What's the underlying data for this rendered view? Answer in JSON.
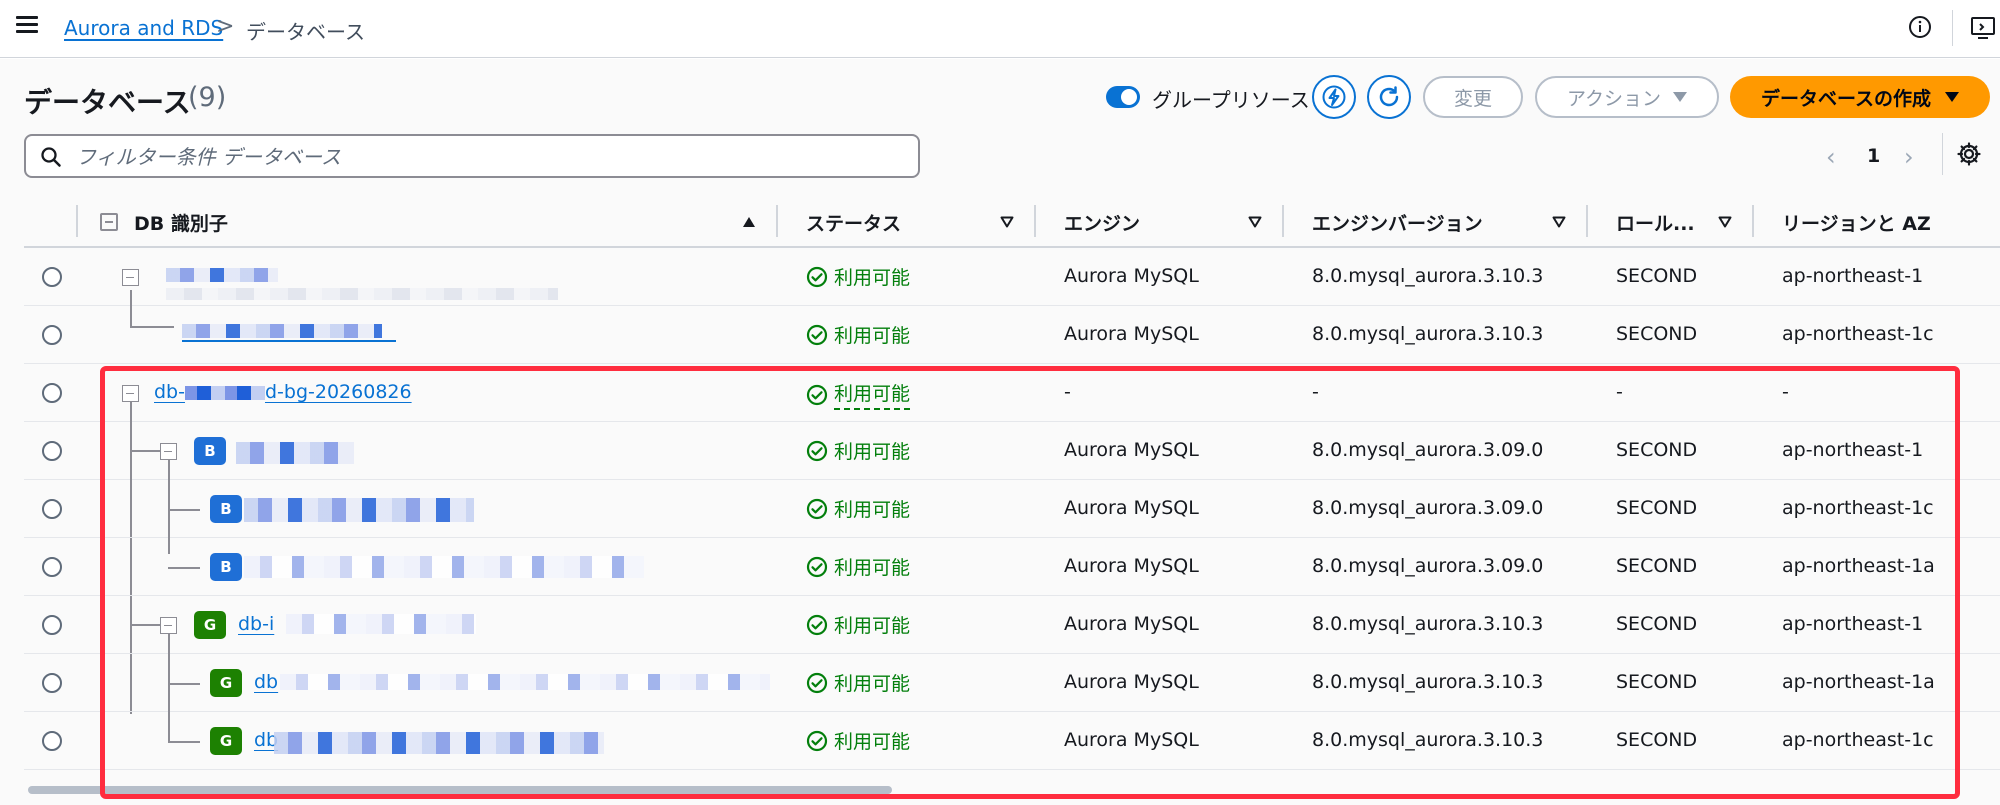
{
  "breadcrumb": {
    "root": "Aurora and RDS",
    "separator": ">",
    "current": "データベース"
  },
  "header": {
    "title": "データベース",
    "count": "(9)",
    "group_toggle_label": "グループリソース",
    "group_toggle_on": true,
    "modify_label": "変更",
    "actions_label": "アクション",
    "create_label": "データベースの作成"
  },
  "search": {
    "placeholder": "フィルター条件 データベース",
    "value": ""
  },
  "pagination": {
    "page": "1"
  },
  "table": {
    "columns": {
      "identifier": "DB 識別子",
      "status": "ステータス",
      "engine": "エンジン",
      "engine_version": "エンジンバージョン",
      "role": "ロール...",
      "region": "リージョンと AZ"
    },
    "rows": [
      {
        "identifier": "",
        "status": "利用可能",
        "engine": "Aurora MySQL",
        "version": "8.0.mysql_aurora.3.10.3",
        "role": "SECOND",
        "region": "ap-northeast-1"
      },
      {
        "identifier": "",
        "status": "利用可能",
        "engine": "Aurora MySQL",
        "version": "8.0.mysql_aurora.3.10.3",
        "role": "SECOND",
        "region": "ap-northeast-1c"
      },
      {
        "identifier_prefix": "db-",
        "identifier_suffix": "d-bg-20260826",
        "status": "利用可能",
        "engine": "-",
        "version": "-",
        "role": "-",
        "region": "-"
      },
      {
        "badge": "B",
        "identifier": "",
        "status": "利用可能",
        "engine": "Aurora MySQL",
        "version": "8.0.mysql_aurora.3.09.0",
        "role": "SECOND",
        "region": "ap-northeast-1"
      },
      {
        "badge": "B",
        "identifier": "",
        "status": "利用可能",
        "engine": "Aurora MySQL",
        "version": "8.0.mysql_aurora.3.09.0",
        "role": "SECOND",
        "region": "ap-northeast-1c"
      },
      {
        "badge": "B",
        "identifier": "",
        "status": "利用可能",
        "engine": "Aurora MySQL",
        "version": "8.0.mysql_aurora.3.09.0",
        "role": "SECOND",
        "region": "ap-northeast-1a"
      },
      {
        "badge": "G",
        "identifier": "db-i",
        "status": "利用可能",
        "engine": "Aurora MySQL",
        "version": "8.0.mysql_aurora.3.10.3",
        "role": "SECOND",
        "region": "ap-northeast-1"
      },
      {
        "badge": "G",
        "identifier": "db",
        "status": "利用可能",
        "engine": "Aurora MySQL",
        "version": "8.0.mysql_aurora.3.10.3",
        "role": "SECOND",
        "region": "ap-northeast-1a"
      },
      {
        "badge": "G",
        "identifier": "db",
        "status": "利用可能",
        "engine": "Aurora MySQL",
        "version": "8.0.mysql_aurora.3.10.3",
        "role": "SECOND",
        "region": "ap-northeast-1c"
      }
    ]
  },
  "icons": {
    "menu": "hamburger-icon",
    "info": "info-icon",
    "screen": "screen-icon",
    "search": "search-icon",
    "lightning": "lightning-icon",
    "refresh": "refresh-icon",
    "settings": "gear-icon",
    "status": "check-circle-icon"
  },
  "colors": {
    "link": "#0972d3",
    "primary": "#ff9900",
    "success": "#037f0c",
    "highlight": "#ff2d3f",
    "badge_blue": "#1f6fd6",
    "badge_green": "#1d8102"
  }
}
